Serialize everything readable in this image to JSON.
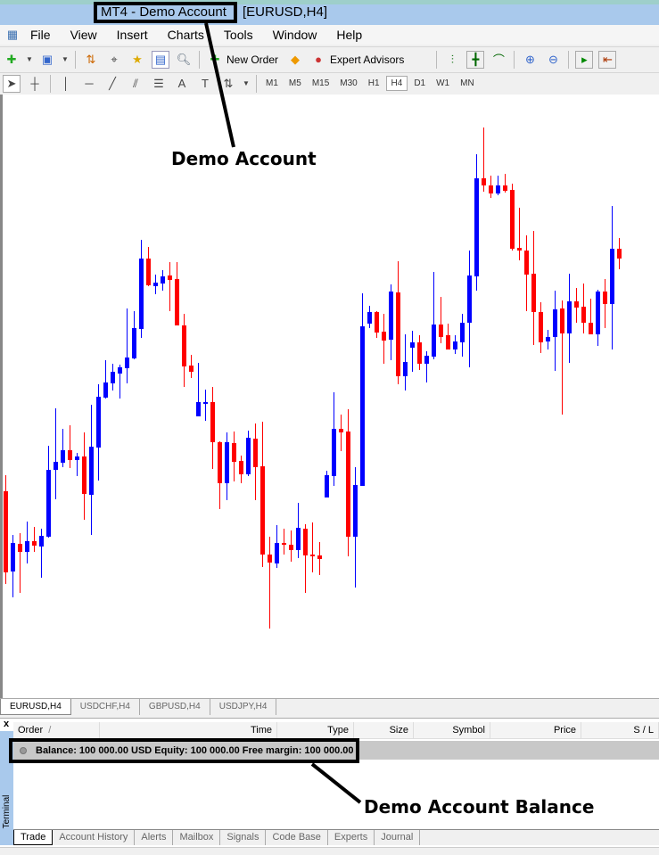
{
  "window": {
    "title": "MT4 - Demo Account",
    "symbol_tf": "[EURUSD,H4]"
  },
  "menu": [
    "File",
    "View",
    "Insert",
    "Charts",
    "Tools",
    "Window",
    "Help"
  ],
  "toolbar": {
    "new_order": "New Order",
    "expert_advisors": "Expert Advisors"
  },
  "timeframes": [
    "M1",
    "M5",
    "M15",
    "M30",
    "H1",
    "H4",
    "D1",
    "W1",
    "MN"
  ],
  "active_timeframe": "H4",
  "chart_tabs": [
    "EURUSD,H4",
    "USDCHF,H4",
    "GBPUSD,H4",
    "USDJPY,H4"
  ],
  "annotations": {
    "demo_account": "Demo Account",
    "demo_balance": "Demo Account Balance"
  },
  "terminal": {
    "label": "Terminal",
    "close": "x",
    "columns": [
      "Order",
      "Time",
      "Type",
      "Size",
      "Symbol",
      "Price",
      "S / L"
    ],
    "sort_indicator": "/",
    "balance_line": "Balance: 100 000.00 USD  Equity: 100 000.00  Free margin: 100 000.00",
    "tabs": [
      "Trade",
      "Account History",
      "Alerts",
      "Mailbox",
      "Signals",
      "Code Base",
      "Experts",
      "Journal"
    ]
  },
  "colors": {
    "bull": "#0000ff",
    "bear": "#ff0000",
    "title_bar": "#a9c9ec"
  },
  "chart_data": {
    "type": "candlestick",
    "symbol": "EURUSD",
    "timeframe": "H4",
    "note_fields": [
      "open",
      "high",
      "low",
      "close"
    ],
    "candles": [
      [
        231,
        249,
        127,
        140
      ],
      [
        141,
        182,
        112,
        173
      ],
      [
        172,
        184,
        117,
        163
      ],
      [
        163,
        197,
        150,
        175
      ],
      [
        175,
        191,
        163,
        170
      ],
      [
        169,
        189,
        134,
        181
      ],
      [
        180,
        282,
        179,
        255
      ],
      [
        255,
        324,
        222,
        264
      ],
      [
        263,
        301,
        258,
        277
      ],
      [
        277,
        305,
        257,
        266
      ],
      [
        266,
        274,
        248,
        270
      ],
      [
        270,
        297,
        199,
        228
      ],
      [
        227,
        328,
        182,
        281
      ],
      [
        280,
        351,
        243,
        337
      ],
      [
        336,
        378,
        335,
        353
      ],
      [
        352,
        374,
        344,
        365
      ],
      [
        363,
        373,
        335,
        370
      ],
      [
        369,
        436,
        352,
        381
      ],
      [
        380,
        433,
        379,
        414
      ],
      [
        413,
        513,
        403,
        492
      ],
      [
        492,
        505,
        461,
        462
      ],
      [
        461,
        474,
        452,
        465
      ],
      [
        464,
        479,
        456,
        472
      ],
      [
        473,
        488,
        433,
        468
      ],
      [
        469,
        488,
        417,
        417
      ],
      [
        417,
        430,
        348,
        371
      ],
      [
        372,
        384,
        358,
        365
      ],
      [
        315,
        375,
        315,
        331
      ],
      [
        329,
        345,
        310,
        331
      ],
      [
        331,
        348,
        256,
        286
      ],
      [
        286,
        287,
        211,
        240
      ],
      [
        240,
        297,
        221,
        286
      ],
      [
        285,
        298,
        242,
        264
      ],
      [
        265,
        271,
        240,
        250
      ],
      [
        250,
        299,
        248,
        291
      ],
      [
        290,
        307,
        221,
        258
      ],
      [
        259,
        309,
        146,
        160
      ],
      [
        160,
        180,
        77,
        151
      ],
      [
        150,
        193,
        145,
        173
      ],
      [
        173,
        189,
        160,
        171
      ],
      [
        171,
        187,
        152,
        165
      ],
      [
        165,
        218,
        156,
        190
      ],
      [
        189,
        194,
        117,
        159
      ],
      [
        160,
        196,
        140,
        159
      ],
      [
        159,
        174,
        137,
        155
      ],
      [
        224,
        254,
        224,
        249
      ],
      [
        248,
        342,
        237,
        301
      ],
      [
        301,
        317,
        276,
        297
      ],
      [
        298,
        323,
        158,
        180
      ],
      [
        180,
        258,
        123,
        238
      ],
      [
        237,
        453,
        237,
        416
      ],
      [
        419,
        439,
        414,
        432
      ],
      [
        432,
        433,
        403,
        409
      ],
      [
        410,
        430,
        374,
        400
      ],
      [
        401,
        463,
        378,
        455
      ],
      [
        454,
        489,
        351,
        360
      ],
      [
        360,
        407,
        344,
        376
      ],
      [
        392,
        411,
        365,
        398
      ],
      [
        398,
        406,
        367,
        374
      ],
      [
        374,
        388,
        353,
        383
      ],
      [
        382,
        477,
        379,
        418
      ],
      [
        418,
        449,
        397,
        404
      ],
      [
        406,
        419,
        390,
        390
      ],
      [
        390,
        406,
        385,
        399
      ],
      [
        398,
        430,
        382,
        420
      ],
      [
        420,
        501,
        370,
        473
      ],
      [
        472,
        609,
        456,
        582
      ],
      [
        582,
        639,
        567,
        574
      ],
      [
        574,
        585,
        560,
        565
      ],
      [
        565,
        585,
        563,
        574
      ],
      [
        574,
        587,
        566,
        568
      ],
      [
        569,
        576,
        501,
        503
      ],
      [
        504,
        549,
        490,
        501
      ],
      [
        501,
        518,
        433,
        474
      ],
      [
        475,
        523,
        395,
        432
      ],
      [
        432,
        443,
        386,
        398
      ],
      [
        399,
        412,
        390,
        404
      ],
      [
        404,
        456,
        366,
        435
      ],
      [
        436,
        445,
        317,
        408
      ],
      [
        408,
        475,
        375,
        444
      ],
      [
        444,
        459,
        420,
        437
      ],
      [
        438,
        464,
        408,
        420
      ],
      [
        420,
        447,
        407,
        407
      ],
      [
        407,
        457,
        394,
        455
      ],
      [
        455,
        469,
        414,
        441
      ],
      [
        441,
        551,
        390,
        503
      ],
      [
        503,
        515,
        480,
        492
      ]
    ]
  }
}
